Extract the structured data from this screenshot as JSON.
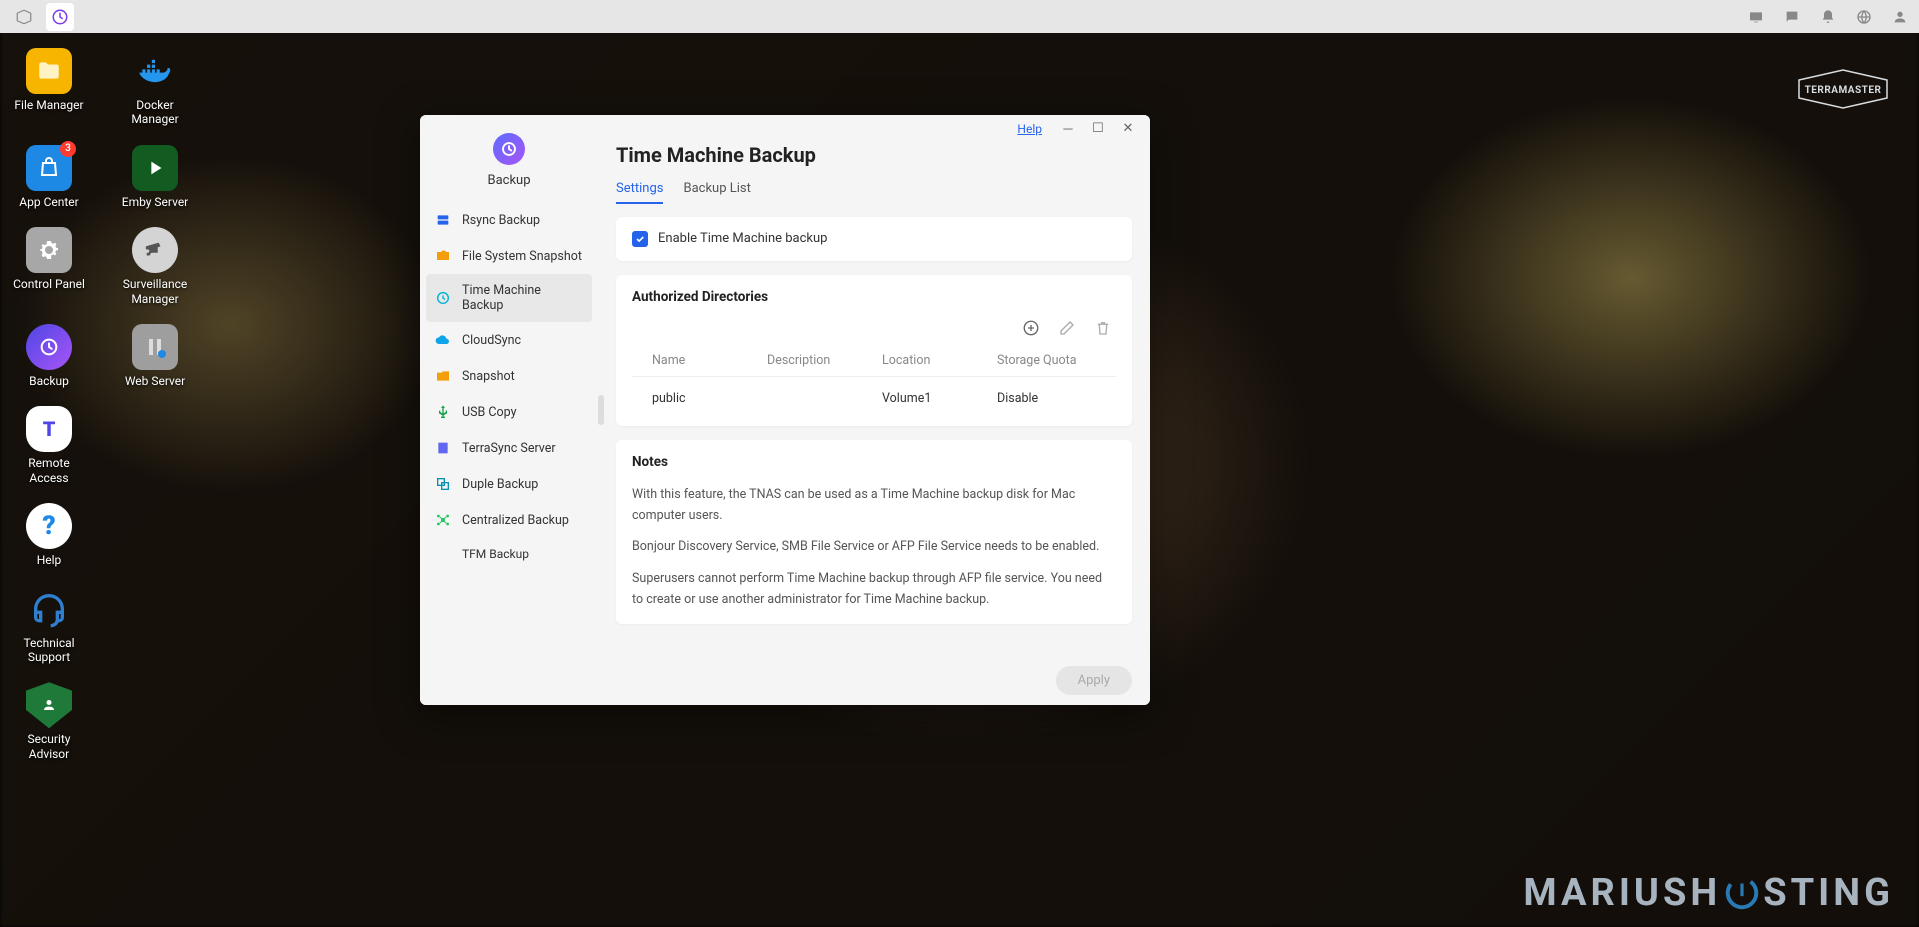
{
  "taskbar": {
    "tray": [
      "monitor",
      "chat",
      "bell",
      "globe",
      "user"
    ]
  },
  "desktop": {
    "badge_appcenter": "3",
    "icons": [
      [
        {
          "key": "file-manager",
          "label": "File Manager",
          "bg": "#f7b500"
        },
        {
          "key": "docker",
          "label": "Docker Manager",
          "bg": "transparent"
        }
      ],
      [
        {
          "key": "app-center",
          "label": "App Center",
          "bg": "#1e88e5",
          "badge": true
        },
        {
          "key": "emby",
          "label": "Emby Server",
          "bg": "#1b5e20"
        }
      ],
      [
        {
          "key": "control-panel",
          "label": "Control Panel",
          "bg": "#9e9e9e"
        },
        {
          "key": "surveillance",
          "label": "Surveillance Manager",
          "bg": "#cfcfcf"
        }
      ],
      [
        {
          "key": "backup",
          "label": "Backup",
          "bg": "linear-gradient(135deg,#4f46e5,#a855f7)"
        },
        {
          "key": "web-server",
          "label": "Web Server",
          "bg": "#888"
        }
      ],
      [
        {
          "key": "remote",
          "label": "Remote Access",
          "bg": "#fff"
        }
      ],
      [
        {
          "key": "help",
          "label": "Help",
          "bg": "#fff"
        }
      ],
      [
        {
          "key": "tech-support",
          "label": "Technical Support",
          "bg": "transparent"
        }
      ],
      [
        {
          "key": "security-advisor",
          "label": "Security Advisor",
          "bg": "#1f7a3a"
        }
      ]
    ]
  },
  "brand": {
    "name": "TERRAMASTER",
    "watermark": "MARIUSH  STING"
  },
  "window": {
    "help_label": "Help",
    "sidebar_title": "Backup",
    "sidebar_items": [
      {
        "label": "Rsync Backup",
        "icon": "rsync",
        "color": "#2563eb"
      },
      {
        "label": "File System Snapshot",
        "icon": "snapshot",
        "color": "#f59e0b"
      },
      {
        "label": "Time Machine Backup",
        "icon": "timemachine",
        "color": "#06b6d4",
        "active": true
      },
      {
        "label": "CloudSync",
        "icon": "cloud",
        "color": "#0ea5e9"
      },
      {
        "label": "Snapshot",
        "icon": "snap",
        "color": "#f59e0b"
      },
      {
        "label": "USB Copy",
        "icon": "usb",
        "color": "#16a34a"
      },
      {
        "label": "TerraSync Server",
        "icon": "terrasync",
        "color": "#6366f1"
      },
      {
        "label": "Duple Backup",
        "icon": "duple",
        "color": "#0891b2"
      },
      {
        "label": "Centralized Backup",
        "icon": "central",
        "color": "#22c55e"
      },
      {
        "label": "TFM Backup",
        "icon": "",
        "indent": true
      }
    ],
    "page_title": "Time Machine Backup",
    "tabs": [
      {
        "label": "Settings",
        "active": true
      },
      {
        "label": "Backup List"
      }
    ],
    "enable_label": "Enable Time Machine backup",
    "auth_title": "Authorized Directories",
    "table": {
      "headers": [
        "Name",
        "Description",
        "Location",
        "Storage Quota"
      ],
      "rows": [
        {
          "name": "public",
          "description": "",
          "location": "Volume1",
          "quota": "Disable"
        }
      ]
    },
    "notes_title": "Notes",
    "notes": [
      "With this feature, the TNAS can be used as a Time Machine backup disk for Mac computer users.",
      "Bonjour Discovery Service, SMB File Service or AFP File Service needs to be enabled.",
      "Superusers cannot perform Time Machine backup through AFP file service. You need to create or use another administrator for Time Machine backup."
    ],
    "apply_label": "Apply"
  }
}
